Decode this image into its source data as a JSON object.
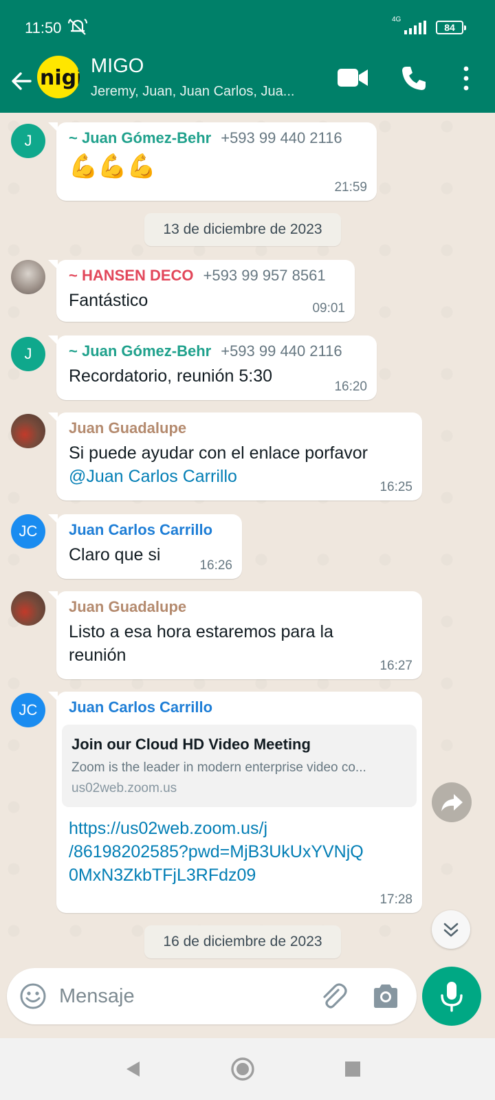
{
  "status_bar": {
    "time": "11:50",
    "network": "4G",
    "battery": "84",
    "icons": [
      "mute-icon",
      "signal-icon",
      "battery-icon"
    ]
  },
  "header": {
    "title": "MIGO",
    "subtitle": "Jeremy, Juan, Juan Carlos, Jua...",
    "avatar_text": "nigi",
    "icons": [
      "back-arrow-icon",
      "video-call-icon",
      "voice-call-icon",
      "more-options-icon"
    ],
    "colors": {
      "bar": "#008069",
      "avatar": "#ffe600"
    }
  },
  "messages": [
    {
      "avatar": "J",
      "sender": "~ Juan Gómez-Behr",
      "phone": "+593 99 440 2116",
      "text": "💪💪💪",
      "time": "21:59"
    },
    {
      "date_divider": "13 de diciembre de 2023"
    },
    {
      "avatar_icon": "group-photo-avatar",
      "sender": "~ HANSEN DECO",
      "phone": "+593 99 957 8561",
      "text": "Fantástico",
      "time": "09:01"
    },
    {
      "avatar": "J",
      "sender": "~ Juan Gómez-Behr",
      "phone": "+593 99 440 2116",
      "text": "Recordatorio, reunión 5:30",
      "time": "16:20"
    },
    {
      "avatar_icon": "photo-avatar",
      "sender": "Juan Guadalupe",
      "text": "Si puede ayudar con el enlace porfavor",
      "mention": "@Juan Carlos Carrillo",
      "time": "16:25"
    },
    {
      "avatar": "JC",
      "sender": "Juan Carlos Carrillo",
      "text": "Claro que si",
      "time": "16:26"
    },
    {
      "avatar_icon": "photo-avatar",
      "sender": "Juan Guadalupe",
      "text_line1": "Listo a esa hora estaremos para la",
      "text_line2": "reunión",
      "time": "16:27"
    },
    {
      "avatar": "JC",
      "sender": "Juan Carlos Carrillo",
      "preview": {
        "title": "Join our Cloud HD Video Meeting",
        "description": "Zoom is the leader in modern enterprise video co...",
        "domain": "us02web.zoom.us"
      },
      "link_line1": "https://us02web.zoom.us/j",
      "link_line2": "/86198202585?pwd=MjB3UkUxYVNjQ",
      "link_line3": "0MxN3ZkbTFjL3RFdz09",
      "time": "17:28"
    },
    {
      "date_divider": "16 de diciembre de 2023"
    }
  ],
  "input": {
    "placeholder": "Mensaje",
    "value": "",
    "icons": [
      "emoji-icon",
      "attach-icon",
      "camera-icon",
      "mic-icon"
    ]
  },
  "floating": {
    "icons": [
      "forward-icon",
      "scroll-down-icon"
    ]
  },
  "nav": {
    "icons": [
      "nav-back-icon",
      "nav-home-icon",
      "nav-recents-icon"
    ]
  },
  "colors": {
    "teal_sender": "#1fa18c",
    "red_sender": "#e2475a",
    "brown_sender": "#b48a6e",
    "blue_sender": "#1e7ed6",
    "link": "#027eb5",
    "mic_button": "#00a884"
  }
}
